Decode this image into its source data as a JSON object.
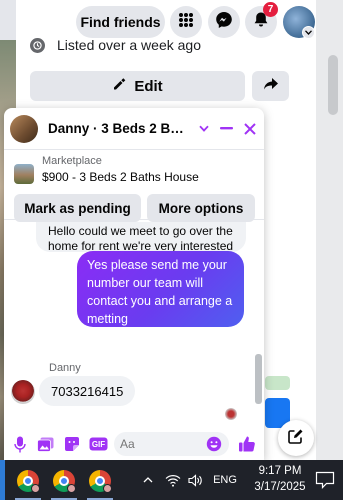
{
  "top_nav": {
    "find_friends_label": "Find friends",
    "notification_count": "7",
    "icons": [
      "menu-grid-icon",
      "messenger-icon",
      "bell-icon",
      "avatar",
      "chevron-down-icon"
    ]
  },
  "background_listing": {
    "listed_text": "Listed over a week ago",
    "edit_label": "Edit"
  },
  "chat": {
    "title": "Danny · 3 Beds 2 Baths H...",
    "listing": {
      "marketplace_label": "Marketplace",
      "info": "$900 - 3 Beds 2 Baths House"
    },
    "buttons": {
      "mark_pending": "Mark as pending",
      "more_options": "More options"
    },
    "messages": [
      {
        "from": "other",
        "text": "Hello could we meet to go over the home for rent we're very interested in"
      },
      {
        "from": "me",
        "text": "Yes please send me your number our team will contact you and arrange a metting"
      },
      {
        "from": "other",
        "sender": "Danny",
        "text": "7033216415"
      }
    ],
    "composer": {
      "placeholder": "Aa"
    },
    "accent_color": "#8b2cf5"
  },
  "taskbar": {
    "language": "ENG",
    "time": "9:17 PM",
    "date": "3/17/2025"
  }
}
